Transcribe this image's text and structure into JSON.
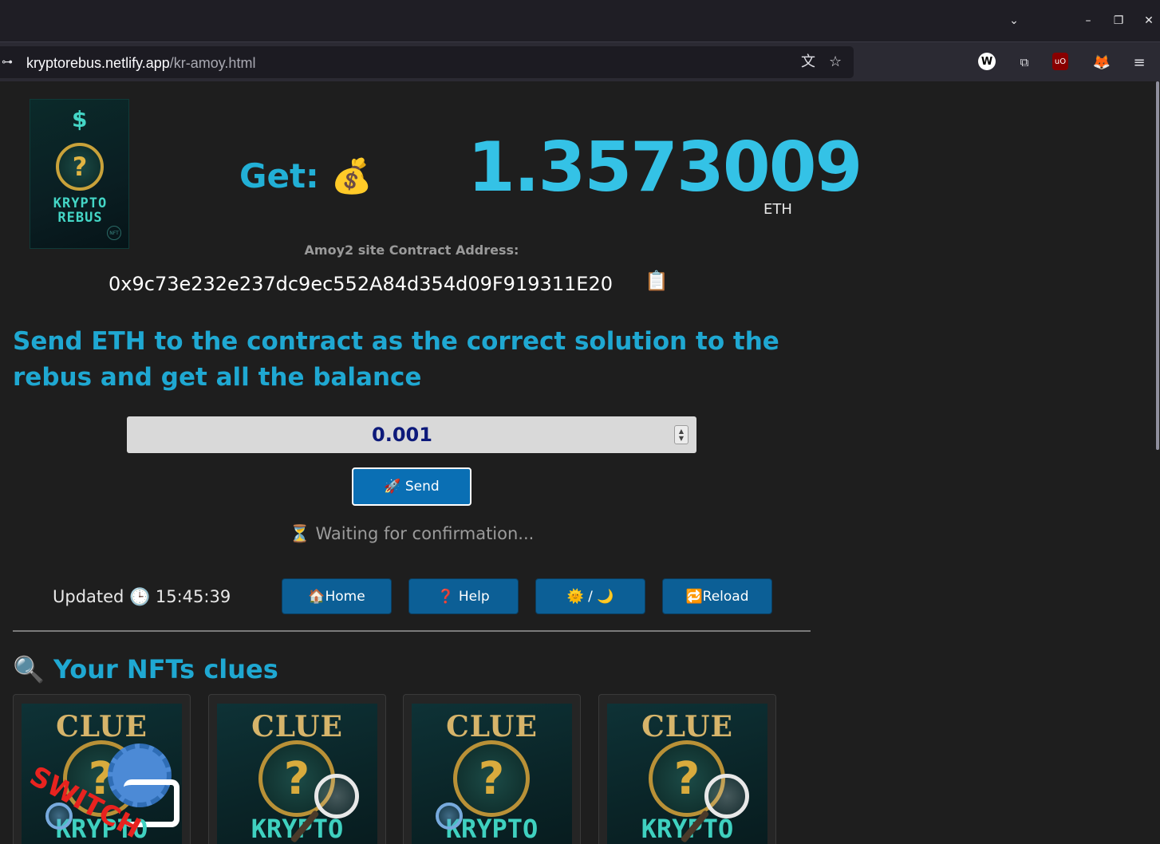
{
  "browser": {
    "url_host": "kryptorebus.netlify.app",
    "url_path": "/kr-amoy.html"
  },
  "prize": {
    "label": "Get:",
    "label_emoji": "💰",
    "amount": "1.3573009",
    "unit": "ETH"
  },
  "contract": {
    "label": "Amoy2 site Contract Address:",
    "address": "0x9c73e232e237dc9ec552A84d354d09F919311E20",
    "copy_icon": "📋"
  },
  "headline": "Send ETH to the contract as the correct solution to the rebus and get all the balance",
  "send_form": {
    "amount_value": "0.001",
    "send_label": "🚀 Send",
    "status": "⏳ Waiting for confirmation..."
  },
  "footer": {
    "updated": "Updated 🕒 15:45:39",
    "buttons": [
      "🏠Home",
      "❓ Help",
      "🌞 / 🌙",
      "🔁Reload"
    ]
  },
  "nfts": {
    "heading": "🔍 Your NFTs clues",
    "cards": [
      {
        "title": "CLUE",
        "caption": "KRYPTO",
        "overlay": "SWITCH"
      },
      {
        "title": "CLUE",
        "caption": "KRYPTO"
      },
      {
        "title": "CLUE",
        "caption": "KRYPTO"
      },
      {
        "title": "CLUE",
        "caption": "KRYPTO"
      }
    ]
  },
  "logo": {
    "line1": "KRYPTO",
    "line2": "REBUS",
    "coin_symbol": "?",
    "badge": "NFT"
  }
}
